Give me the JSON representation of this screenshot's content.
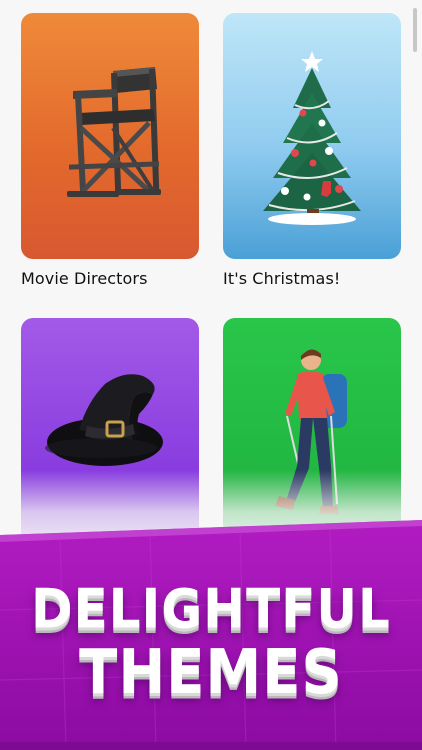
{
  "cards": [
    {
      "label": "Movie Directors",
      "theme_color": "#e36a2c",
      "icon": "directors-chair-icon"
    },
    {
      "label": "It's Christmas!",
      "theme_color": "#8fcbef",
      "icon": "christmas-tree-icon"
    },
    {
      "label": "",
      "theme_color": "#8a3ee0",
      "icon": "witch-hat-icon"
    },
    {
      "label": "",
      "theme_color": "#22b842",
      "icon": "hiker-icon"
    }
  ],
  "promo": {
    "line1": "DELIGHTFUL",
    "line2": "THEMES",
    "banner_color": "#a117b4"
  }
}
